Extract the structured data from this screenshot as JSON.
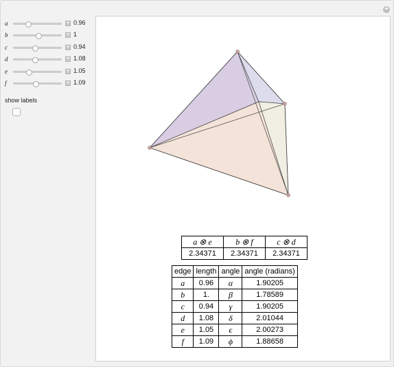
{
  "sliders": [
    {
      "name": "a",
      "value": "0.96",
      "position": 0.3
    },
    {
      "name": "b",
      "value": "1",
      "position": 0.52
    },
    {
      "name": "c",
      "value": "0.94",
      "position": 0.45
    },
    {
      "name": "d",
      "value": "1.08",
      "position": 0.45
    },
    {
      "name": "e",
      "value": "1.05",
      "position": 0.32
    },
    {
      "name": "f",
      "value": "1.09",
      "position": 0.47
    }
  ],
  "show_labels": {
    "label": "show labels",
    "checked": false
  },
  "products": {
    "headers": [
      "a ⊗ e",
      "b ⊗ f",
      "c ⊗ d"
    ],
    "values": [
      "2.34371",
      "2.34371",
      "2.34371"
    ]
  },
  "edge_table": {
    "headers": [
      "edge",
      "length",
      "angle",
      "angle (radians)"
    ],
    "rows": [
      {
        "edge": "a",
        "length": "0.96",
        "angle": "α",
        "radians": "1.90205"
      },
      {
        "edge": "b",
        "length": "1.",
        "angle": "β",
        "radians": "1.78589"
      },
      {
        "edge": "c",
        "length": "0.94",
        "angle": "γ",
        "radians": "1.90205"
      },
      {
        "edge": "d",
        "length": "1.08",
        "angle": "δ",
        "radians": "2.01044"
      },
      {
        "edge": "e",
        "length": "1.05",
        "angle": "ϵ",
        "radians": "2.00273"
      },
      {
        "edge": "f",
        "length": "1.09",
        "angle": "ϕ",
        "radians": "1.88658"
      }
    ]
  },
  "colors": {
    "face_left": "#d8cde3",
    "face_right_top": "#dcdcec",
    "face_bottom": "#f4e3d8",
    "face_right": "#f1efe3",
    "vertex": "#c8a0a0"
  }
}
